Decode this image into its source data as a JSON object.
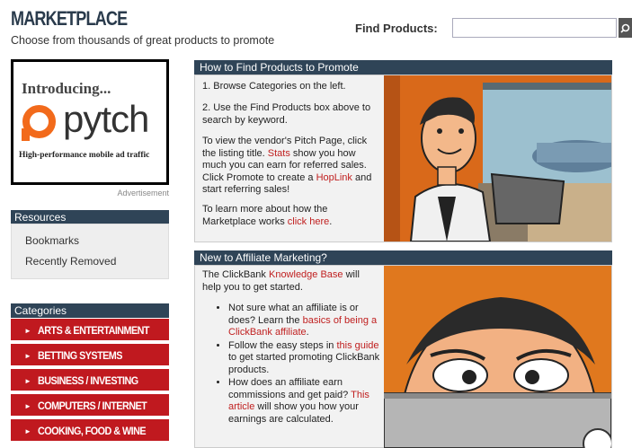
{
  "header": {
    "title": "MARKETPLACE",
    "subtitle": "Choose from thousands of great products to promote",
    "find_label": "Find Products:",
    "search_value": "",
    "search_button_icon": "search-icon"
  },
  "ad": {
    "intro": "Introducing...",
    "brand": "pytch",
    "tagline": "High-performance mobile ad traffic",
    "caption": "Advertisement"
  },
  "resources": {
    "title": "Resources",
    "items": [
      {
        "label": "Bookmarks"
      },
      {
        "label": "Recently Removed"
      }
    ]
  },
  "categories": {
    "title": "Categories",
    "items": [
      {
        "label": "ARTS & ENTERTAINMENT"
      },
      {
        "label": "BETTING SYSTEMS"
      },
      {
        "label": "BUSINESS / INVESTING"
      },
      {
        "label": "COMPUTERS / INTERNET"
      },
      {
        "label": "COOKING, FOOD & WINE"
      }
    ]
  },
  "how_to": {
    "title": "How to Find Products to Promote",
    "step1": "1. Browse Categories on the left.",
    "step2": "2. Use the Find Products box above to search by keyword.",
    "para_a": "To view the vendor's Pitch Page, click the listing title.",
    "link_stats": "Stats",
    "para_b": "show you how much you can earn for referred sales. Click Promote to create a",
    "link_hoplink": "HopLink",
    "para_c": "and start referring sales!",
    "learn_text": "To learn more about how the Marketplace works",
    "learn_link": "click here",
    "learn_end": "."
  },
  "affiliate": {
    "title": "New to Affiliate Marketing?",
    "intro_a": "The ClickBank",
    "intro_link": "Knowledge Base",
    "intro_b": "will help you to get started.",
    "bullet1_a": "Not sure what an affiliate is or does? Learn the",
    "bullet1_link": "basics of being a ClickBank affiliate",
    "bullet1_b": ".",
    "bullet2_a": "Follow the easy steps in",
    "bullet2_link": "this guide",
    "bullet2_b": "to get started promoting ClickBank products.",
    "bullet3_a": "How does an affiliate earn commissions and get paid?",
    "bullet3_link": "This article",
    "bullet3_b": "will show you how your earnings are calculated."
  },
  "colors": {
    "nav_dark": "#2f4457",
    "category_red": "#c0191f",
    "link_red": "#c02020",
    "brand_orange": "#f26a1b"
  }
}
